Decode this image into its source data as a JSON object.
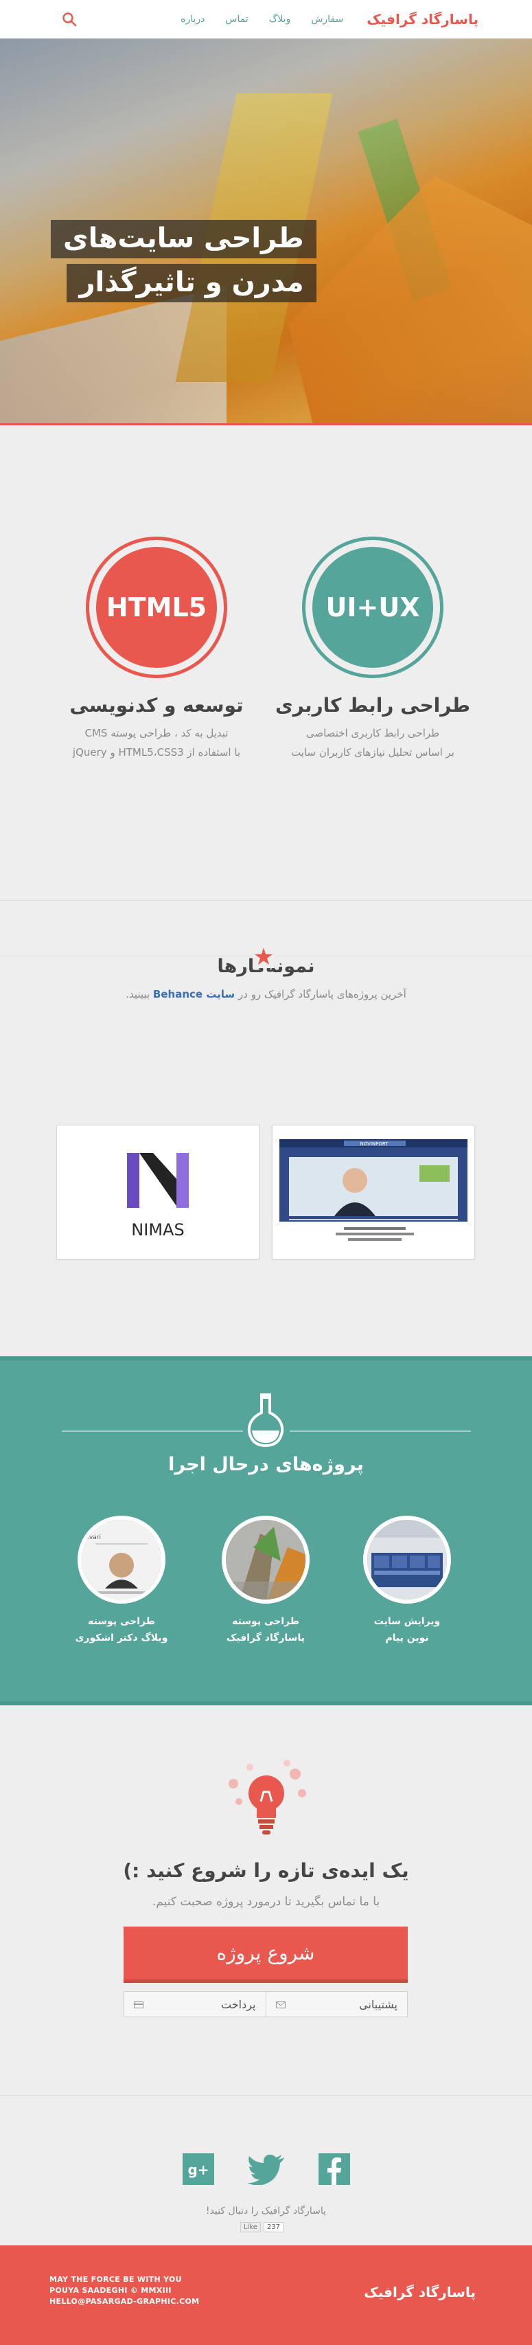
{
  "nav": {
    "brand": "پاسارگاد گرافیک",
    "links": [
      "سفارش",
      "وبلاگ",
      "تماس",
      "درباره"
    ],
    "search_icon": "search-icon"
  },
  "hero": {
    "title_line1": "طراحی سایت‌های",
    "title_line2": "مدرن و تاثیرگذار"
  },
  "features": [
    {
      "badge": "UI+UX",
      "title": "طراحی رابط کاربری",
      "line1": "طراحی رابط کاربری اختصاصی",
      "line2": "بر اساس تحلیل نیازهای کاربران سایت",
      "color": "#55a59a"
    },
    {
      "badge": "HTML5",
      "title": "توسعه و کدنویسی",
      "line1": "تبدیل به کد ، طراحی پوسته CMS",
      "line2": "با استفاده از HTML5،CSS3 و jQuery",
      "color": "#e9584e"
    }
  ],
  "portfolio": {
    "title": "نمونه‌کارها",
    "sub_before": "آخرین پروژه‌های پاسارگاد گرافیک رو در",
    "sub_link": "سایت Behance",
    "sub_after": "ببینید.",
    "cards": [
      {
        "name": "NOVINPORT"
      },
      {
        "name": "NIMAS"
      }
    ]
  },
  "projects": {
    "title": "پروژه‌های درحال اجرا",
    "items": [
      {
        "line1": "ویرایش سایت",
        "line2": "نوین پیام"
      },
      {
        "line1": "طراحی پوسته",
        "line2": "پاسارگاد گرافیک"
      },
      {
        "line1": "طراحی پوسته",
        "line2": "وبلاگ دکتر اشکوری"
      }
    ],
    "thumb_label": "Dr.Eshkevari"
  },
  "cta": {
    "title": "یک ایده‌ی تازه را شروع کنید :)",
    "sub": "با ما تماس بگیرید تا درمورد پروژه صحبت کنیم.",
    "start_label": "شروع پروژه",
    "support_label": "پشتیبانی",
    "payment_label": "پرداخت"
  },
  "social": {
    "follow": "پاسارگاد گرافیک را دنبال کنید!",
    "like_label": "Like",
    "like_count": "237"
  },
  "footer": {
    "line1": "MAY THE FORCE BE WITH YOU",
    "line2": "POUYA SAADEGHI © MMXIII",
    "line3": "HELLO@PASARGAD-GRAPHIC.COM",
    "brand": "پاسارگاد گرافیک"
  },
  "colors": {
    "accent": "#e9584e",
    "teal": "#55a59a",
    "link": "#3b6fb6"
  }
}
